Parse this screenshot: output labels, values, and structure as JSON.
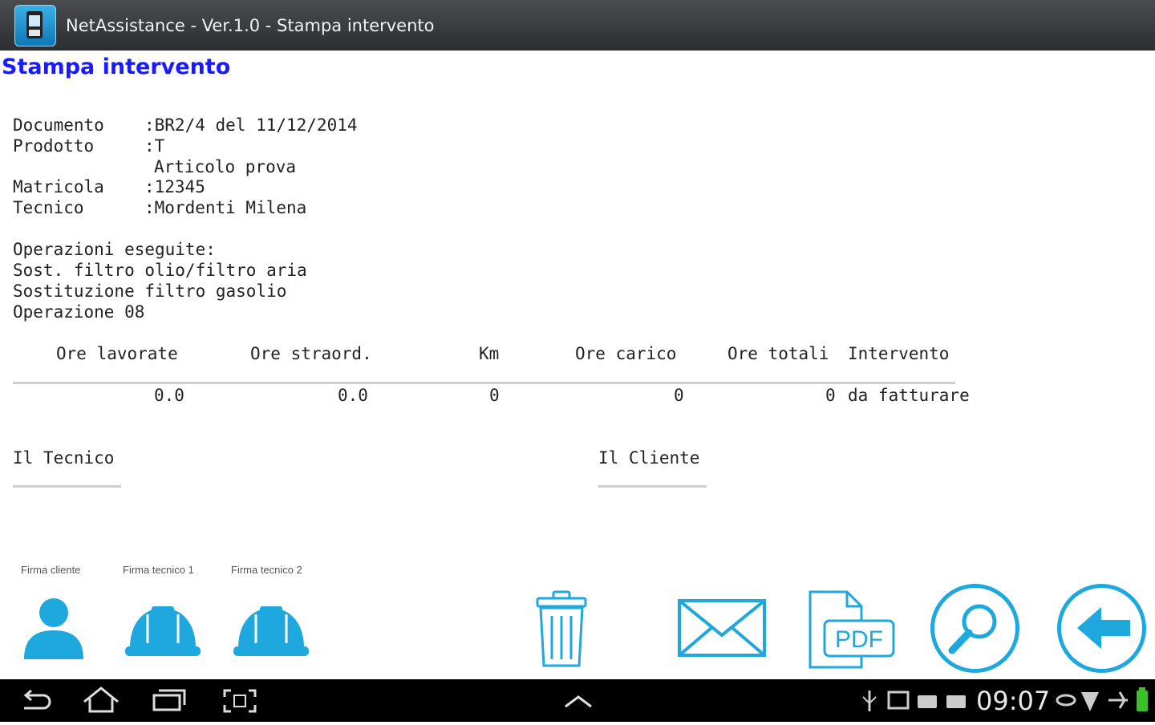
{
  "app": {
    "title": "NetAssistance - Ver.1.0 - Stampa intervento"
  },
  "page": {
    "title": "Stampa intervento"
  },
  "document": {
    "documento_label": "Documento",
    "documento_value": ":BR2/4 del 11/12/2014",
    "prodotto_label": "Prodotto",
    "prodotto_value": ":T",
    "prodotto_desc": "Articolo prova",
    "matricola_label": "Matricola",
    "matricola_value": ":12345",
    "tecnico_label": "Tecnico",
    "tecnico_value": ":Mordenti Milena"
  },
  "operations": {
    "heading": "Operazioni eseguite:",
    "items": [
      "Sost. filtro olio/filtro aria",
      "Sostituzione filtro gasolio",
      "Operazione 08"
    ]
  },
  "summary": {
    "headers": [
      "Ore lavorate",
      "Ore straord.",
      "Km",
      "Ore carico",
      "Ore totali",
      "Intervento"
    ],
    "values": [
      "0.0",
      "0.0",
      "0",
      "0",
      "0",
      "da fatturare"
    ]
  },
  "signatures": {
    "tecnico": "Il Tecnico",
    "cliente": "Il Cliente"
  },
  "signature_buttons": [
    "Firma cliente",
    "Firma tecnico 1",
    "Firma tecnico 2"
  ],
  "actions": {
    "pdf_label": "PDF"
  },
  "status_bar": {
    "time": "09:07"
  },
  "colors": {
    "accent": "#1ea8dd",
    "title": "#1a1aff"
  }
}
